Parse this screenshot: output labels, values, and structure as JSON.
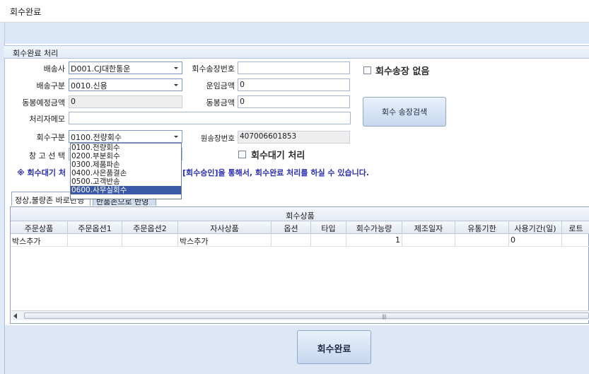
{
  "window": {
    "title": "회수완료"
  },
  "group": {
    "title": "회수완료 처리"
  },
  "form": {
    "carrier": {
      "label": "배송사",
      "value": "D001.CJ대한통운"
    },
    "return_invoice_no": {
      "label": "회수송장번호",
      "value": ""
    },
    "delivery_type": {
      "label": "배송구분",
      "value": "0010.신용"
    },
    "freight_amount": {
      "label": "운임금액",
      "value": "0"
    },
    "enclosed_expected_amount": {
      "label": "동봉예정금액",
      "value": "0"
    },
    "enclosed_amount": {
      "label": "동봉금액",
      "value": "0"
    },
    "handler_memo": {
      "label": "처리자메모",
      "value": ""
    },
    "return_type": {
      "label": "회수구분",
      "value": "0100.전량회수"
    },
    "original_invoice_no": {
      "label": "원송장번호",
      "value": "407006601853"
    },
    "warehouse_select": {
      "label": "창 고 선 택",
      "value": ""
    }
  },
  "checkboxes": {
    "no_return_invoice": {
      "label": "회수송장 없음",
      "checked": false
    },
    "return_wait_process": {
      "label": "회수대기 처리",
      "checked": false
    }
  },
  "buttons": {
    "invoice_search": "회수 송장검색",
    "complete": "회수완료"
  },
  "notice": {
    "prefix": "※ 회수대기 처",
    "suffix": "[회수승인]을 통해서, 회수완료 처리를 하실 수 있습니다."
  },
  "return_type_dropdown": {
    "options": [
      "0100.전량회수",
      "0200.부분회수",
      "0300.제품파손",
      "0400.사은품결손",
      "0500.고객반송",
      "0600.사무실회수"
    ],
    "highlighted_index": 5
  },
  "tabs": [
    {
      "label": "정상,불량존 바로반영",
      "active": true
    },
    {
      "label": "반품존으로 반영",
      "active": false
    }
  ],
  "grid": {
    "band_title": "회수상품",
    "columns": [
      "주문상품",
      "주문옵션1",
      "주문옵션2",
      "자사상품",
      "옵션",
      "타입",
      "회수가능량",
      "제조일자",
      "유통기한",
      "사용기간(일)",
      "로트"
    ],
    "rows": [
      [
        "박스추가",
        "",
        "",
        "박스추가",
        "",
        "",
        "1",
        "",
        "",
        "0",
        ""
      ]
    ]
  }
}
